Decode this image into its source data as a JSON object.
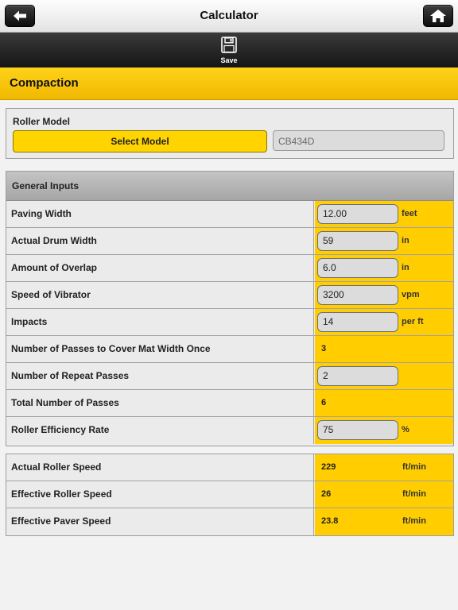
{
  "header": {
    "title": "Calculator",
    "back_icon": "back-arrow-icon",
    "home_icon": "home-icon"
  },
  "toolbar": {
    "save_label": "Save",
    "save_icon": "floppy-disk-icon"
  },
  "section": {
    "title": "Compaction"
  },
  "roller": {
    "label": "Roller Model",
    "select_label": "Select Model",
    "model_value": "CB434D"
  },
  "general": {
    "title": "General Inputs",
    "rows": [
      {
        "label": "Paving Width",
        "value": "12.00",
        "unit": "feet"
      },
      {
        "label": "Actual Drum Width",
        "value": "59",
        "unit": "in"
      },
      {
        "label": "Amount of Overlap",
        "value": "6.0",
        "unit": "in"
      },
      {
        "label": "Speed of Vibrator",
        "value": "3200",
        "unit": "vpm"
      },
      {
        "label": "Impacts",
        "value": "14",
        "unit": "per ft"
      },
      {
        "label": "Number of Passes to Cover Mat Width Once",
        "value": "3",
        "unit": ""
      },
      {
        "label": "Number of Repeat Passes",
        "value": "2",
        "unit": ""
      },
      {
        "label": "Total Number of Passes",
        "value": "6",
        "unit": ""
      },
      {
        "label": "Roller Efficiency Rate",
        "value": "75",
        "unit": "%"
      }
    ]
  },
  "results": {
    "rows": [
      {
        "label": "Actual Roller Speed",
        "value": "229",
        "unit": "ft/min"
      },
      {
        "label": "Effective Roller Speed",
        "value": "26",
        "unit": "ft/min"
      },
      {
        "label": "Effective Paver Speed",
        "value": "23.8",
        "unit": "ft/min"
      }
    ]
  },
  "colors": {
    "accent": "#ffcd00",
    "toolbar": "#1e1e1e",
    "field": "#dcdcdc"
  }
}
